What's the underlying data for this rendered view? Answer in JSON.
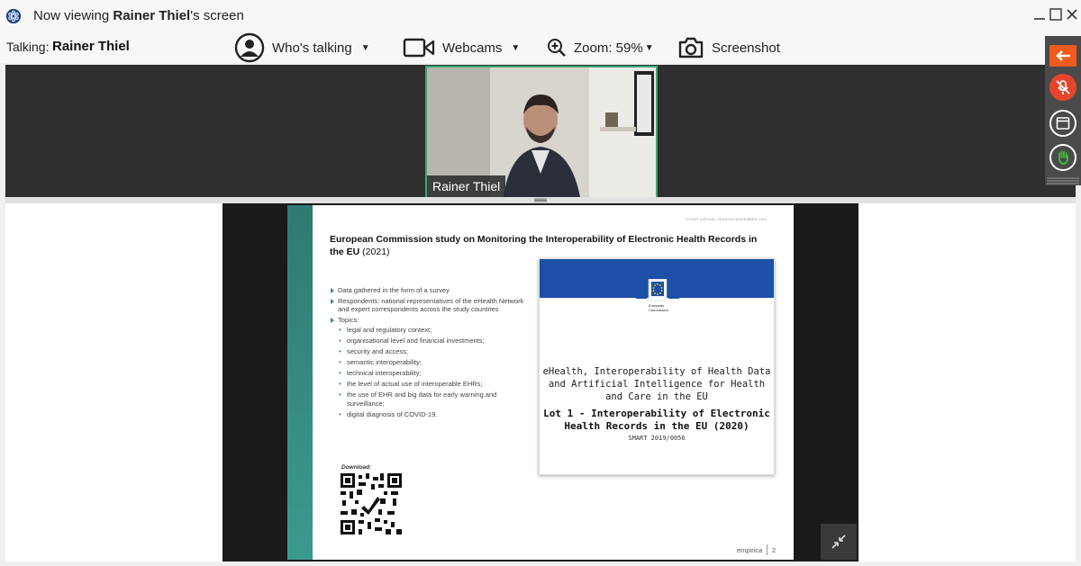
{
  "window": {
    "title_prefix": "Now viewing ",
    "presenter": "Rainer Thiel",
    "title_suffix": "'s screen"
  },
  "toolbar": {
    "talking_label": "Talking:",
    "talking_name": "Rainer Thiel",
    "whos_talking": "Who's talking",
    "webcams": "Webcams",
    "zoom": "Zoom: 59%",
    "screenshot": "Screenshot"
  },
  "webcam": {
    "name": "Rainer Thiel"
  },
  "slide": {
    "header": "CODIR VIRTUAL SESSION NOVEMBER 2021",
    "title_bold": "European Commission study on Monitoring the Interoperability of Electronic Health Records in the EU",
    "title_year": " (2021)",
    "bullets": [
      "Data gathered in the form of a survey",
      "Respondents: national representatives of the eHealth Network and expert correspondents across the study countries",
      "Topics:"
    ],
    "topics": [
      "legal and regulatory context;",
      "organisational level and financial investments;",
      "security and access;",
      "semantic interoperability;",
      "technical interoperability;",
      "the level of actual use of interoperable EHRs;",
      "the use of EHR and big data for early warning and surveillance;",
      "digital diagnosis of COVID-19."
    ],
    "download_label": "Download:",
    "report": {
      "logo_line1": "European",
      "logo_line2": "Commission",
      "subtitle": "eHealth, Interoperability of Health Data and Artificial Intelligence for Health and Care in the EU",
      "lot": "Lot 1 - Interoperability of Electronic Health Records in the EU (2020)",
      "code": "SMART 2019/0056"
    },
    "brand": "empirica",
    "page": "2"
  },
  "colors": {
    "accent": "#3aa676",
    "eu_blue": "#1e4fa6",
    "teal": "#3b9a8f",
    "panel_orange": "#f05a1a",
    "panel_red": "#e8442b"
  }
}
